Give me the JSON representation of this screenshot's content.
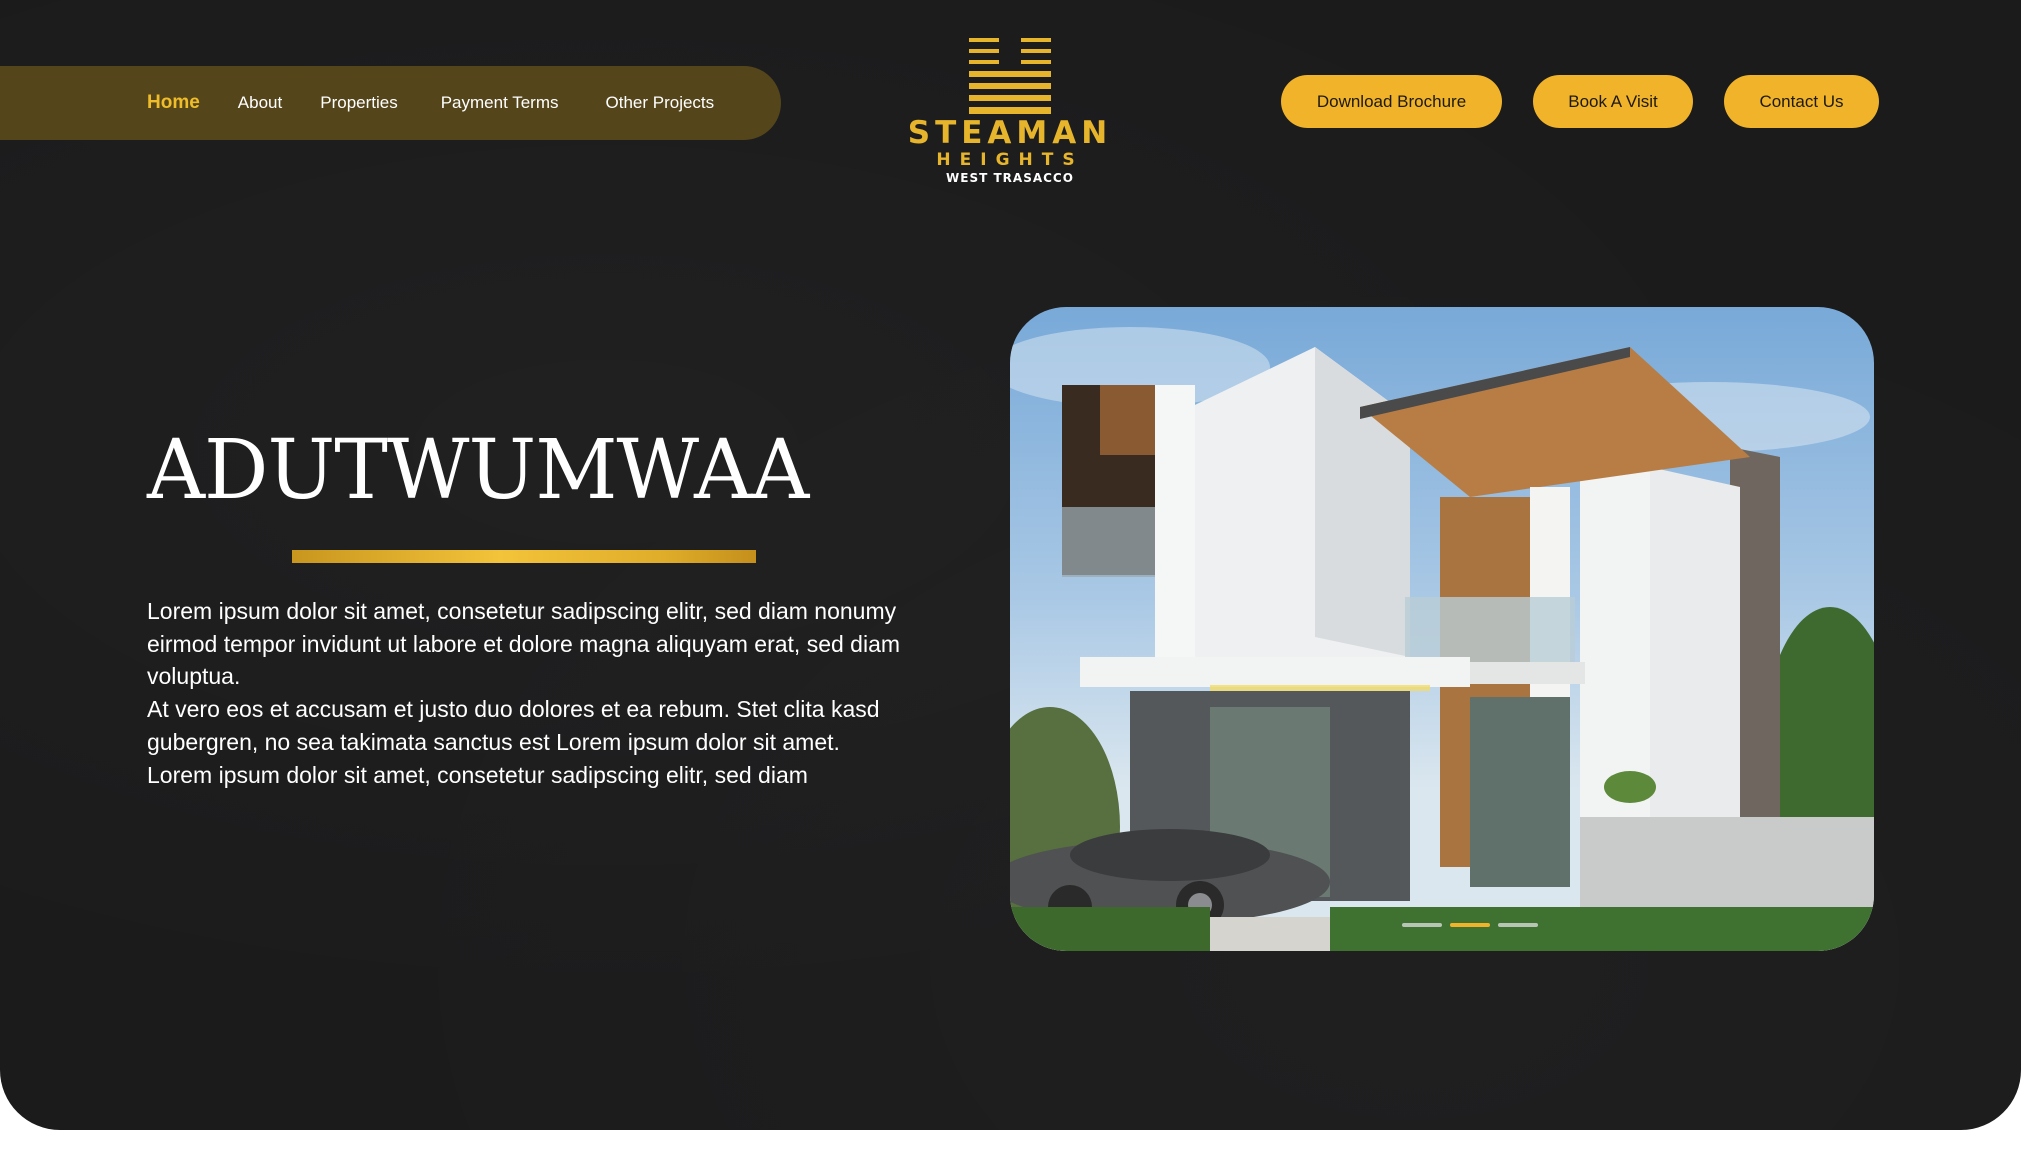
{
  "nav": {
    "items": [
      {
        "label": "Home",
        "active": true
      },
      {
        "label": "About"
      },
      {
        "label": "Properties"
      },
      {
        "label": "Payment Terms"
      },
      {
        "label": "Other Projects"
      }
    ]
  },
  "logo": {
    "title": "STEAMAN",
    "subtitle": "HEIGHTS",
    "location": "WEST TRASACCO",
    "icon": "building-lines-icon"
  },
  "cta": {
    "brochure_label": "Download Brochure",
    "visit_label": "Book A Visit",
    "contact_label": "Contact Us"
  },
  "hero": {
    "title": "ADUTWUMWAA",
    "paragraphs": [
      "Lorem ipsum dolor sit amet, consetetur sadipscing elitr, sed diam nonumy eirmod tempor invidunt ut labore et dolore magna aliquyam erat, sed diam voluptua.",
      "At vero eos et accusam et justo duo dolores et ea rebum. Stet clita kasd gubergren, no sea takimata sanctus est Lorem ipsum dolor sit amet. Lorem ipsum dolor sit amet, consetetur sadipscing elitr, sed diam"
    ],
    "carousel": {
      "total": 3,
      "active_index": 1
    }
  },
  "colors": {
    "background": "#1b1b1c",
    "accent": "#f0b32a",
    "nav_pill": "#55451b",
    "logo_gold": "#e7b52c"
  }
}
